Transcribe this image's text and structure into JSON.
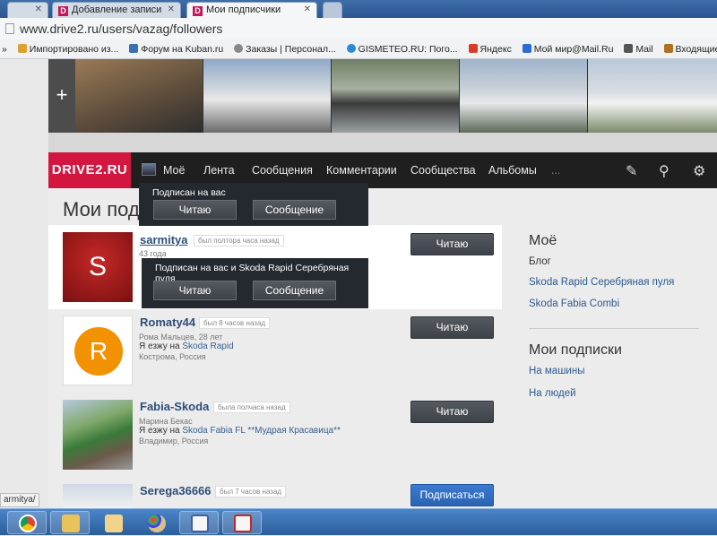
{
  "browser": {
    "tabs": [
      {
        "label": "",
        "icon": "blank-tab-icon"
      },
      {
        "label": "Добавление записи",
        "icon": "drive2-favicon"
      },
      {
        "label": "Мои подписчики",
        "icon": "drive2-favicon"
      },
      {
        "label": "",
        "icon": "new-tab-icon"
      }
    ],
    "address": "www.drive2.ru/users/vazag/followers",
    "bookmarks": [
      {
        "label": "Импортировано из...",
        "icon": "folder-icon",
        "color": "#e0a030"
      },
      {
        "label": "Форум на Kuban.ru",
        "icon": "forum-icon",
        "color": "#3a6fb5"
      },
      {
        "label": "Заказы | Персонал...",
        "icon": "orders-icon",
        "color": "#888888"
      },
      {
        "label": "GISMETEO.RU: Пого...",
        "icon": "weather-icon",
        "color": "#2a8ad6"
      },
      {
        "label": "Яндекс",
        "icon": "yandex-icon",
        "color": "#d93a2a"
      },
      {
        "label": "Мой мир@Mail.Ru",
        "icon": "mailru-icon",
        "color": "#2d6bd2"
      },
      {
        "label": "Mail",
        "icon": "mail-icon",
        "color": "#555555"
      },
      {
        "label": "Входящие - vazag@...",
        "icon": "inbox-icon",
        "color": "#b07020"
      }
    ]
  },
  "site": {
    "logo": "DRIVE2.RU",
    "nav": [
      "Моё",
      "Лента",
      "Сообщения",
      "Комментарии",
      "Сообщества",
      "Альбомы",
      "..."
    ],
    "nav_icons": [
      "pencil-icon",
      "search-icon",
      "gear-icon"
    ],
    "page_title": "Мои подп"
  },
  "tooltips": [
    {
      "text": "Подписан на вас",
      "btn_read": "Читаю",
      "btn_msg": "Сообщение"
    },
    {
      "text": "Подписан на вас и Skoda Rapid Серебряная пуля",
      "btn_read": "Читаю",
      "btn_msg": "Сообщение"
    }
  ],
  "users": [
    {
      "name": "sarmitya",
      "status": "был полтора часа назад",
      "meta": "43 года",
      "avatar_letter": "S",
      "drive_prefix": "",
      "drive_car": "",
      "location": "",
      "button": "Читаю",
      "button_style": "dark"
    },
    {
      "name": "Romaty44",
      "status": "был 8 часов назад",
      "meta": "Рома Мальцев, 28 лет",
      "avatar_letter": "R",
      "drive_prefix": "Я езжу на ",
      "drive_car": "Skoda Rapid",
      "location": "Кострома, Россия",
      "button": "Читаю",
      "button_style": "dark"
    },
    {
      "name": "Fabia-Skoda",
      "status": "была полчаса назад",
      "meta": "Марина Бекас",
      "avatar_letter": "",
      "drive_prefix": "Я езжу на ",
      "drive_car": "Skoda Fabia FL **Мудрая Красавица**",
      "location": "Владимир, Россия",
      "button": "Читаю",
      "button_style": "dark"
    },
    {
      "name": "Serega36666",
      "status": "был 7 часов назад",
      "meta": "",
      "avatar_letter": "",
      "drive_prefix": "",
      "drive_car": "",
      "location": "",
      "button": "Подписаться",
      "button_style": "blue"
    }
  ],
  "sidebar": {
    "section1_title": "Моё",
    "blog": "Блог",
    "cars": [
      "Skoda Rapid Серебряная пуля",
      "Skoda Fabia Combi"
    ],
    "section2_title": "Мои подписки",
    "sub_links": [
      "На машины",
      "На людей"
    ]
  },
  "statusbar": "armitya/",
  "colors": {
    "accent": "#d2163f",
    "nav_bg": "#1f1f1f",
    "link": "#2d5a8e"
  }
}
